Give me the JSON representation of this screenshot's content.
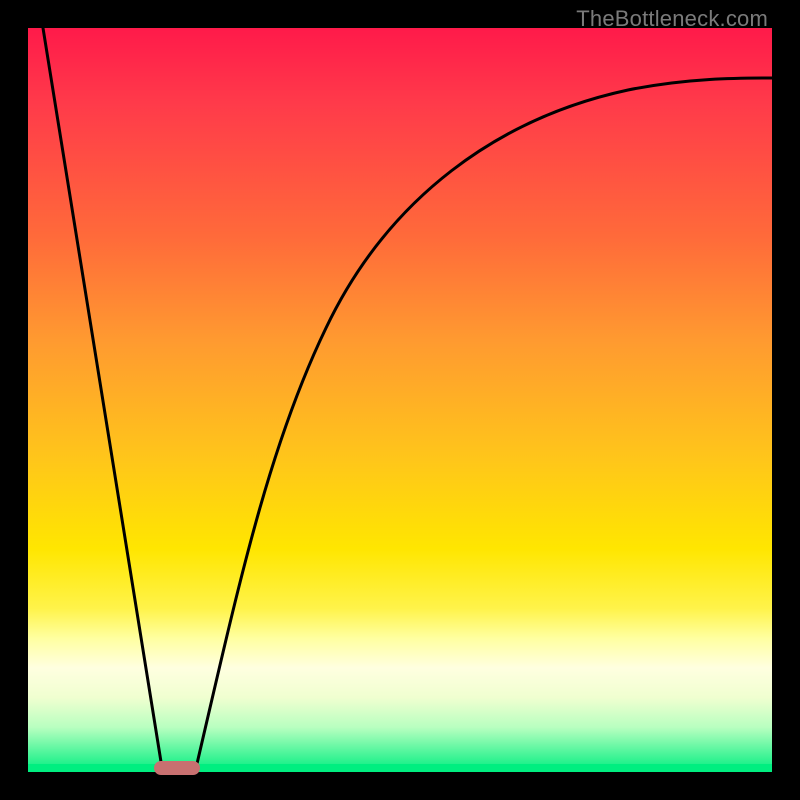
{
  "watermark": "TheBottleneck.com",
  "colors": {
    "frame_border": "#000000",
    "gradient_top": "#ff1a4a",
    "gradient_bottom": "#00ee80",
    "curve_stroke": "#000000",
    "marker_fill": "#c87070",
    "watermark_text": "#7a7a7a"
  },
  "chart_data": {
    "type": "line",
    "title": "",
    "xlabel": "",
    "ylabel": "",
    "xlim": [
      0,
      100
    ],
    "ylim": [
      0,
      100
    ],
    "grid": false,
    "legend": false,
    "series": [
      {
        "name": "left-leg",
        "x": [
          2,
          18
        ],
        "values": [
          100,
          0
        ]
      },
      {
        "name": "right-curve",
        "x": [
          22,
          25,
          28,
          32,
          36,
          40,
          45,
          50,
          56,
          63,
          72,
          82,
          92,
          100
        ],
        "values": [
          0,
          12,
          24,
          36,
          48,
          57,
          66,
          73,
          79,
          84,
          88,
          90.5,
          92,
          93
        ]
      }
    ],
    "marker": {
      "x_center": 20,
      "width_pct": 6,
      "y": 0
    },
    "notes": "Background is a vertical red→orange→yellow→green gradient. Curves are read off as percentage of chart height; axes are unlabeled. Values approximate."
  }
}
